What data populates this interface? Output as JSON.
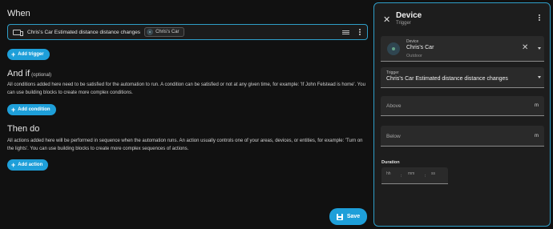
{
  "when": {
    "title": "When",
    "trigger_label": "Chris's Car Estimated distance distance changes",
    "trigger_chip": "Chris's Car",
    "add_trigger": "Add trigger"
  },
  "and_if": {
    "title": "And if",
    "optional": "(optional)",
    "description": "All conditions added here need to be satisfied for the automation to run. A condition can be satisfied or not at any given time, for example: 'If John Felstead is home'. You can use building blocks to create more complex conditions.",
    "add_condition": "Add condition"
  },
  "then_do": {
    "title": "Then do",
    "description": "All actions added here will be performed in sequence when the automation runs. An action usually controls one of your areas, devices, or entities, for example: 'Turn on the lights'. You can use building blocks to create more complex sequences of actions.",
    "add_action": "Add action"
  },
  "save_label": "Save",
  "panel": {
    "title": "Device",
    "subtitle": "Trigger",
    "device_field": {
      "label": "Device",
      "value": "Chris's Car",
      "sub": "Outdoor"
    },
    "trigger_field": {
      "label": "Trigger",
      "value": "Chris's Car Estimated distance distance changes"
    },
    "above_field": {
      "placeholder": "Above",
      "unit": "m"
    },
    "below_field": {
      "placeholder": "Below",
      "unit": "m"
    },
    "duration": {
      "label": "Duration",
      "hh": "hh",
      "mm": "mm",
      "ss": "ss",
      "sep": ":"
    }
  },
  "colors": {
    "accent": "#1e9fd9",
    "border_accent": "#2f9ec8",
    "background": "#111111",
    "panel": "#1d1d1d"
  }
}
